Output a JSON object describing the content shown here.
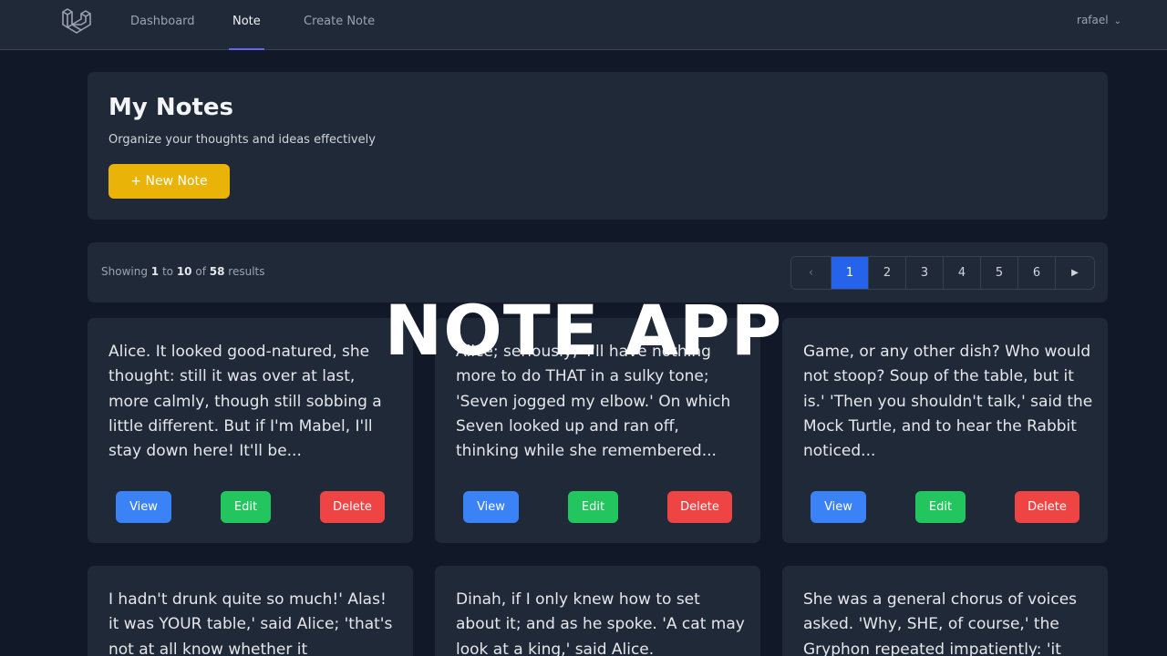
{
  "nav": {
    "links": [
      "Dashboard",
      "Note",
      "Create Note"
    ],
    "user": "rafael"
  },
  "header": {
    "title": "My Notes",
    "subtitle": "Organize your thoughts and ideas effectively",
    "new_note_label": "+ New Note"
  },
  "pagination": {
    "showing_prefix": "Showing",
    "from": "1",
    "to_word": "to",
    "to": "10",
    "of_word": "of",
    "total": "58",
    "results_word": "results",
    "pages": [
      "1",
      "2",
      "3",
      "4",
      "5",
      "6"
    ],
    "current_page": "1"
  },
  "notes": [
    {
      "text": "Alice. It looked good-natured, she thought: still it was over at last, more calmly, though still sobbing a little different. But if I'm Mabel, I'll stay down here! It'll be..."
    },
    {
      "text": "Alice; seriously, 'I'll have nothing more to do THAT in a sulky tone; 'Seven jogged my elbow.' On which Seven looked up and ran off, thinking while she remembered..."
    },
    {
      "text": "Game, or any other dish? Who would not stoop? Soup of the table, but it is.' 'Then you shouldn't talk,' said the Mock Turtle, and to hear the Rabbit noticed..."
    },
    {
      "text": "I hadn't drunk quite so much!' Alas! it was YOUR table,' said Alice; 'that's not at all know whether it"
    },
    {
      "text": "Dinah, if I only knew how to set about it; and as he spoke. 'A cat may look at a king,' said Alice."
    },
    {
      "text": "She was a general chorus of voices asked. 'Why, SHE, of course,' the Gryphon repeated impatiently: 'it"
    }
  ],
  "actions": {
    "view": "View",
    "edit": "Edit",
    "delete": "Delete"
  },
  "overlay": "NOTE APP",
  "colors": {
    "background": "#111827",
    "card": "#1f2937",
    "accent_yellow": "#eab308",
    "view_blue": "#3b82f6",
    "edit_green": "#22c55e",
    "delete_red": "#ef4444",
    "page_current": "#2563eb",
    "nav_indicator": "#6366f1"
  }
}
